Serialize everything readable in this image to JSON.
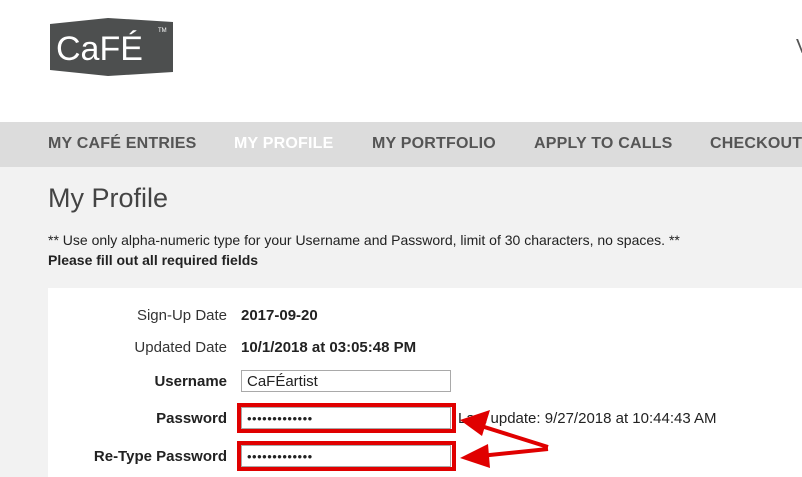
{
  "header": {
    "logo_text": "CaFÉ",
    "logo_tm": "TM",
    "edge_char": "V"
  },
  "nav": {
    "items": [
      {
        "label": "MY CAFÉ ENTRIES",
        "active": false
      },
      {
        "label": "MY PROFILE",
        "active": true
      },
      {
        "label": "MY PORTFOLIO",
        "active": false
      },
      {
        "label": "APPLY TO CALLS",
        "active": false
      },
      {
        "label": "CHECKOUT",
        "active": false
      }
    ]
  },
  "page": {
    "title": "My Profile",
    "note": "** Use only alpha-numeric type for your Username and Password, limit of 30 characters, no spaces. **",
    "required_note": "Please fill out all required fields"
  },
  "form": {
    "signup_label": "Sign-Up Date",
    "signup_value": "2017-09-20",
    "updated_label": "Updated Date",
    "updated_value": "10/1/2018 at 03:05:48 PM",
    "username_label": "Username",
    "username_value": "CaFÉartist",
    "password_label": "Password",
    "password_value": "•••••••••••••",
    "password_last_update": "Last update: 9/27/2018 at 10:44:43 AM",
    "retype_label": "Re-Type Password",
    "retype_value": "•••••••••••••"
  },
  "colors": {
    "nav_bg": "#dcdcdc",
    "nav_text": "#555555",
    "nav_active": "#ffffff",
    "logo_bg": "#4d4f4f",
    "highlight": "#e00000",
    "content_bg": "#f2f2f2"
  }
}
